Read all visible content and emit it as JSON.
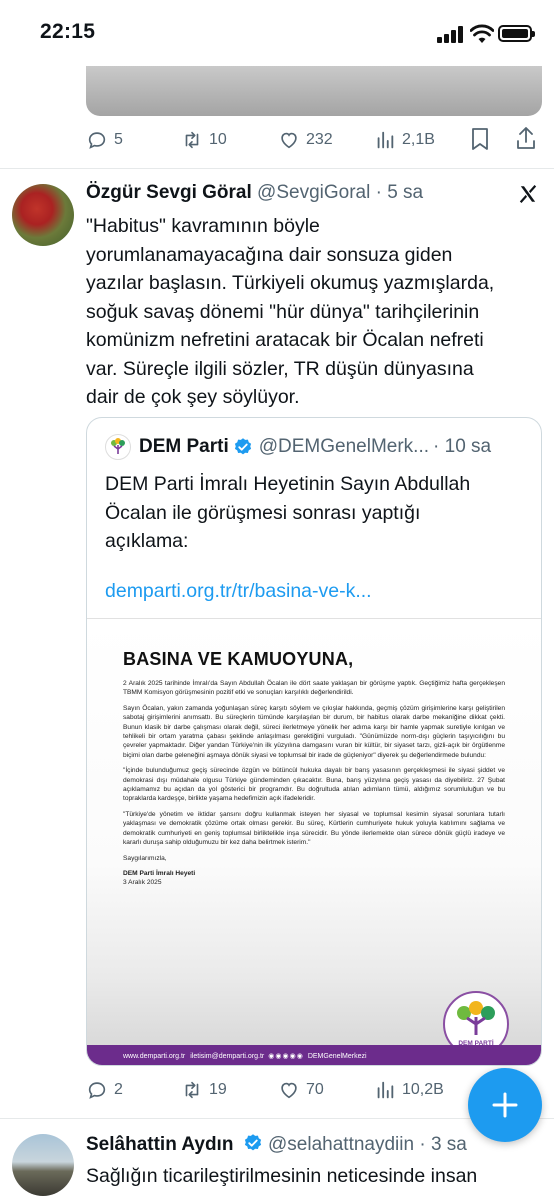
{
  "status_bar": {
    "time": "22:15"
  },
  "prev_tweet": {
    "replies": "5",
    "retweets": "10",
    "likes": "232",
    "views": "2,1B"
  },
  "tweet": {
    "author_name": "Özgür Sevgi Göral",
    "handle": "@SevgiGoral",
    "time": "· 5 sa",
    "lines": [
      "\"Habitus\" kavramının böyle",
      "yorumlanamayacağına dair sonsuza giden",
      "yazılar başlasın. Türkiyeli okumuş yazmışlarda,",
      "soğuk savaş dönemi \"hür dünya\" tarihçilerinin",
      "komünizm nefretini aratacak bir Öcalan nefreti",
      "var. Süreçle ilgili sözler, TR düşün dünyasına",
      "dair de çok şey söylüyor."
    ],
    "replies": "2",
    "retweets": "19",
    "likes": "70",
    "views": "10,2B"
  },
  "quote": {
    "author_name": "DEM Parti",
    "handle": "@DEMGenelMerk...",
    "time": "· 10 sa",
    "lines": [
      "DEM Parti İmralı Heyetinin Sayın Abdullah",
      "Öcalan ile görüşmesi sonrası yaptığı",
      "açıklama:"
    ],
    "link": "demparti.org.tr/tr/basina-ve-k..."
  },
  "press_release": {
    "title": "BASINA VE KAMUOYUNA,",
    "paragraphs": [
      "2 Aralık 2025 tarihinde İmralı'da Sayın Abdullah Öcalan ile dört saate yaklaşan bir görüşme yaptık. Geçtiğimiz hafta gerçekleşen TBMM Komisyon görüşmesinin pozitif etki ve sonuçları karşılıklı değerlendirildi.",
      "Sayın Öcalan, yakın zamanda yoğunlaşan süreç karşıtı söylem ve çıkışlar hakkında, geçmiş çözüm girişimlerine karşı geliştirilen sabotaj girişimlerini anımsattı. Bu süreçlerin tümünde karşılaşılan bir durum, bir habitus olarak darbe mekaniğine dikkat çekti. Bunun klasik bir darbe çalışması olarak değil, süreci ilerletmeye yönelik her adıma karşı bir hamle yapmak suretiyle kırılgan ve tehlikeli bir ortam yaratma çabası şeklinde anlaşılması gerektiğini vurguladı. \"Günümüzde norm-dışı güçlerin taşıyıcılığını bu çevreler yapmaktadır. Diğer yandan Türkiye'nin ilk yüzyılına damgasını vuran bir kültür, bir siyaset tarzı, gizli-açık bir örgütlenme biçimi olan darbe geleneğini aşmaya dönük siyasi ve toplumsal bir irade de güçleniyor\" diyerek şu değerlendirmede bulundu:",
      "\"İçinde bulunduğumuz geçiş sürecinde özgün ve bütüncül hukuka dayalı bir barış yasasının gerçekleşmesi ile siyasi şiddet ve demokrasi dışı müdahale olgusu Türkiye gündeminden çıkacaktır. Buna, barış yüzyılına geçiş yasası da diyebiliriz. 27 Şubat açıklamamız bu açıdan da yol gösterici bir programdır. Bu doğrultuda atılan adımların tümü, aldığımız sorumluluğun ve bu topraklarda kardeşçe, birlikte yaşama hedefimizin açık ifadeleridir.",
      "\"Türkiye'de yönetim ve iktidar şansını doğru kullanmak isteyen her siyasal ve toplumsal kesimin siyasal sorunlara tutarlı yaklaşması ve demokratik çözüme ortak olması gerekir. Bu süreç, Kürtlerin cumhuriyete hukuk yoluyla katılımını sağlama ve demokratik cumhuriyeti en geniş toplumsal birliktelikle inşa sürecidir. Bu yönde ilerlemekte olan sürece dönük güçlü iradeye ve kararlı duruşa sahip olduğumuzu bir kez daha belirtmek isterim.\"",
      "Saygılarımızla,"
    ],
    "signature": "DEM Parti İmralı Heyeti",
    "date": "3 Aralık 2025",
    "logo_label": "DEM PARTİ",
    "footer_site": "www.demparti.org.tr",
    "footer_email": "iletisim@demparti.org.tr",
    "footer_handle": "DEMGenelMerkezi"
  },
  "next_tweet": {
    "author_name": "Selâhattin Aydın",
    "handle": "@selahattnaydiin",
    "time": "· 3 sa",
    "line": "Sağlığın ticarileştirilmesinin neticesinde insan"
  },
  "colors": {
    "accent": "#1d9bf0",
    "muted": "#536471",
    "party_purple": "#6c2c8c"
  }
}
